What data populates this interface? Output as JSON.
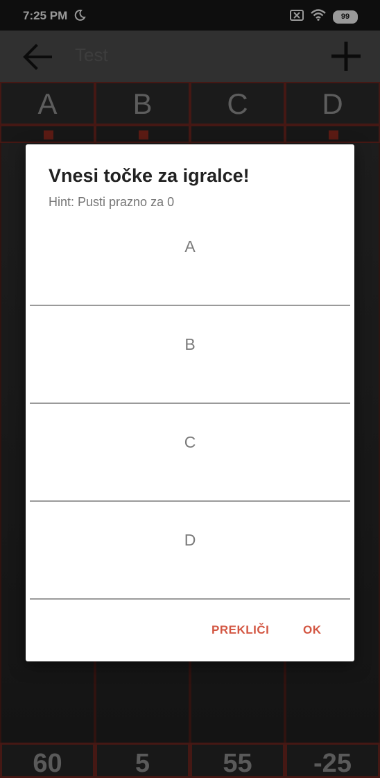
{
  "status": {
    "time": "7:25 PM",
    "battery": "99"
  },
  "appbar": {
    "title": "Test"
  },
  "table": {
    "columns": [
      "A",
      "B",
      "C",
      "D"
    ],
    "totals": [
      "60",
      "5",
      "55",
      "-25"
    ]
  },
  "dialog": {
    "title": "Vnesi točke za igralce!",
    "hint": "Hint: Pusti prazno za 0",
    "fields": [
      {
        "label": "A",
        "value": ""
      },
      {
        "label": "B",
        "value": ""
      },
      {
        "label": "C",
        "value": ""
      },
      {
        "label": "D",
        "value": ""
      }
    ],
    "cancel_label": "PREKLIČI",
    "ok_label": "OK"
  },
  "colors": {
    "accent": "#d35642",
    "grid_border": "#6b2520",
    "appbar": "#4b4b4b"
  },
  "icons": [
    "moon-icon",
    "no-sim-icon",
    "wifi-icon",
    "battery-icon",
    "back-arrow-icon",
    "add-icon"
  ]
}
